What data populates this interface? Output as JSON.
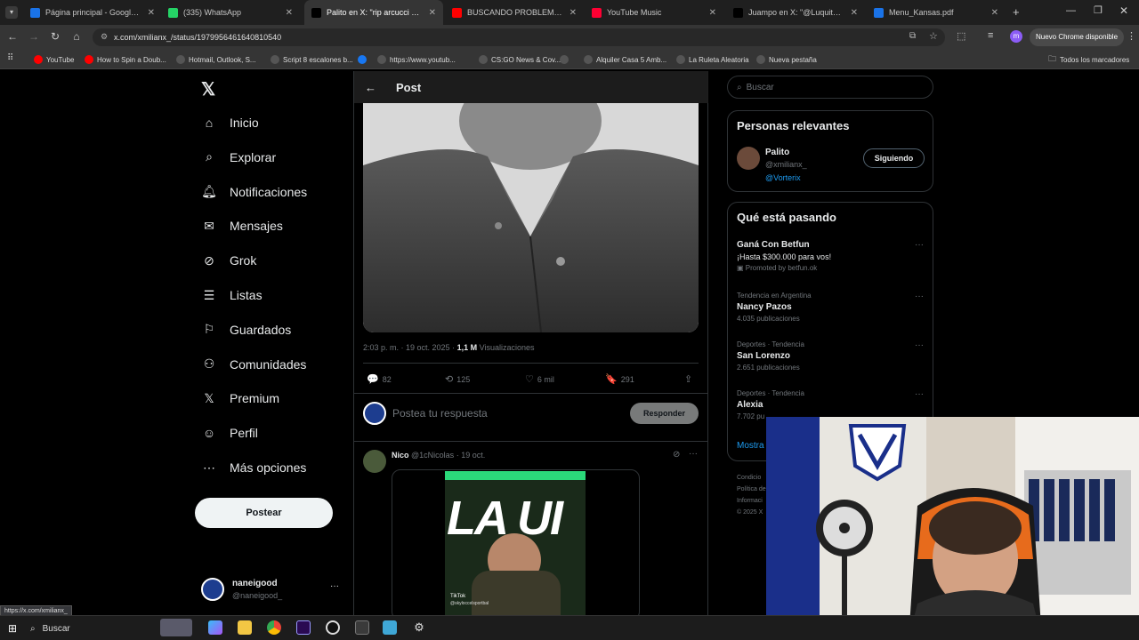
{
  "browser": {
    "tabs": [
      {
        "title": "Página principal - Google Drive",
        "icon": "google-drive-icon",
        "color": "#1a73e8"
      },
      {
        "title": "(335) WhatsApp",
        "icon": "whatsapp-icon",
        "color": "#25d366"
      },
      {
        "title": "Palito en X: \"rip arcucci se nos",
        "icon": "x-icon",
        "color": "#000000"
      },
      {
        "title": "BUSCANDO PROBLEMAS EN B",
        "icon": "youtube-icon",
        "color": "#ff0000"
      },
      {
        "title": "YouTube Music",
        "icon": "youtube-music-icon",
        "color": "#ff0033"
      },
      {
        "title": "Juampo en X: \"@Luquita26_ @",
        "icon": "x-icon",
        "color": "#000000"
      },
      {
        "title": "Menu_Kansas.pdf",
        "icon": "pdf-icon",
        "color": "#1a73e8"
      }
    ],
    "url": "x.com/xmilianx_/status/1979956461640810540",
    "profile_button": "Nuevo Chrome disponible",
    "bookmarks": [
      {
        "label": "YouTube",
        "color": "#ff0000"
      },
      {
        "label": "How to Spin a Doub...",
        "color": "#ff0000"
      },
      {
        "label": "Hotmail, Outlook, S...",
        "color": "#ffffff"
      },
      {
        "label": "Script 8 escalones b...",
        "color": "#ffffff"
      },
      {
        "label": "",
        "color": "#1877f2"
      },
      {
        "label": "https://www.youtub...",
        "color": "#ffffff"
      },
      {
        "label": "CS:GO News & Cov...",
        "color": "#ffffff"
      },
      {
        "label": "",
        "color": "#ffffff"
      },
      {
        "label": "Alquiler Casa 5 Amb...",
        "color": "#ffffff"
      },
      {
        "label": "La Ruleta Aleatoria",
        "color": "#ffffff"
      },
      {
        "label": "Nueva pestaña",
        "color": "#ffffff"
      }
    ],
    "all_bookmarks": "Todos los marcadores",
    "status_url": "https://x.com/xmilianx_"
  },
  "nav": {
    "items": [
      {
        "label": "Inicio",
        "icon": "home-icon"
      },
      {
        "label": "Explorar",
        "icon": "search-icon"
      },
      {
        "label": "Notificaciones",
        "icon": "bell-icon"
      },
      {
        "label": "Mensajes",
        "icon": "mail-icon"
      },
      {
        "label": "Grok",
        "icon": "grok-icon"
      },
      {
        "label": "Listas",
        "icon": "list-icon"
      },
      {
        "label": "Guardados",
        "icon": "bookmark-icon"
      },
      {
        "label": "Comunidades",
        "icon": "people-icon"
      },
      {
        "label": "Premium",
        "icon": "x-icon"
      },
      {
        "label": "Perfil",
        "icon": "person-icon"
      },
      {
        "label": "Más opciones",
        "icon": "more-icon"
      }
    ],
    "post_button": "Postear",
    "account_name": "naneigood",
    "account_handle": "@naneigood_"
  },
  "post": {
    "header_title": "Post",
    "timestamp": "2:03 p. m. · 19 oct. 2025 ·",
    "views_count": "1,1 M",
    "views_label": "Visualizaciones",
    "replies": "82",
    "reposts": "125",
    "likes": "6 mil",
    "bookmarks": "291",
    "reply_placeholder": "Postea tu respuesta",
    "reply_button": "Responder"
  },
  "reply": {
    "name": "Nico",
    "handle": "@1cNicolas",
    "date": "· 19 oct.",
    "video_text": "LA UI",
    "tiktok_label": "TikTok",
    "tiktok_handle": "@skyloccelsportbal"
  },
  "sidebar": {
    "search_placeholder": "Buscar",
    "relevant_title": "Personas relevantes",
    "relevant_person": {
      "name": "Palito",
      "handle": "@xmilianx_",
      "link": "@Vorterix",
      "button": "Siguiendo"
    },
    "trending_title": "Qué está pasando",
    "promo": {
      "name": "Ganá Con Betfun",
      "text": "¡Hasta $300.000 para vos!",
      "promoted": "Promoted by betfun.ok"
    },
    "trends": [
      {
        "meta": "Tendencia en Argentina",
        "name": "Nancy Pazos",
        "count": "4.035 publicaciones"
      },
      {
        "meta": "Deportes · Tendencia",
        "name": "San Lorenzo",
        "count": "2.651 publicaciones"
      },
      {
        "meta": "Deportes · Tendencia",
        "name": "Alexia",
        "count": "7.702 pu"
      }
    ],
    "show_more": "Mostra",
    "footer": [
      "Condicio",
      "Política de",
      "Informaci",
      "© 2025 X"
    ]
  },
  "taskbar": {
    "search_label": "Buscar"
  }
}
